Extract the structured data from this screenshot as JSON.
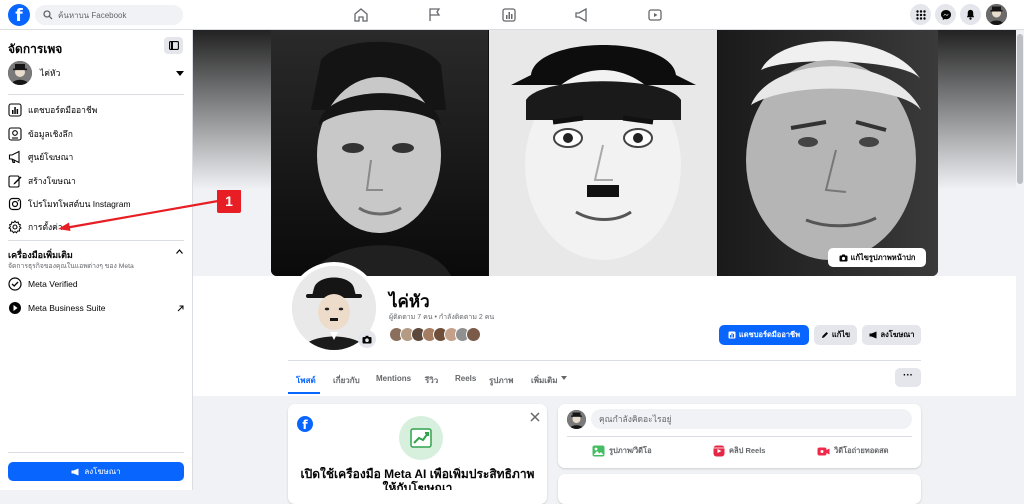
{
  "header": {
    "search_placeholder": "ค้นหาบน Facebook"
  },
  "sidebar": {
    "title": "จัดการเพจ",
    "profile_name": "ไค่หัว",
    "items": [
      {
        "label": "แดชบอร์ดมืออาชีพ",
        "icon": "dashboard-icon"
      },
      {
        "label": "ข้อมูลเชิงลึก",
        "icon": "insights-icon"
      },
      {
        "label": "ศูนย์โฆษณา",
        "icon": "megaphone-icon"
      },
      {
        "label": "สร้างโฆษณา",
        "icon": "edit-icon"
      },
      {
        "label": "โปรโมทโพสต์บน Instagram",
        "icon": "instagram-icon"
      },
      {
        "label": "การตั้งค่า",
        "icon": "gear-icon"
      }
    ],
    "tools_title": "เครื่องมือเพิ่มเติม",
    "tools_subtitle": "จัดการธุรกิจของคุณในแอพต่างๆ ของ Meta",
    "tools": [
      {
        "label": "Meta Verified",
        "icon": "verified-icon"
      },
      {
        "label": "Meta Business Suite",
        "icon": "business-suite-icon"
      }
    ],
    "promote_label": "ลงโฆษณา"
  },
  "annotation": {
    "number": "1"
  },
  "page": {
    "name": "ไค่หัว",
    "stats": "ผู้ติดตาม 7 คน • กำลังติดตาม 2 คน",
    "edit_cover": "แก้ไขรูปภาพหน้าปก",
    "dashboard_btn": "แดชบอร์ดมืออาชีพ",
    "edit_btn": "แก้ไข",
    "ads_btn": "ลงโฆษณา",
    "tabs": [
      "โพสต์",
      "เกี่ยวกับ",
      "Mentions",
      "รีวิว",
      "Reels",
      "รูปภาพ",
      "เพิ่มเติม"
    ]
  },
  "meta_ai_card": {
    "title": "เปิดใช้เครื่องมือ Meta AI เพื่อเพิ่มประสิทธิภาพให้กับโฆษณา"
  },
  "composer": {
    "placeholder": "คุณกำลังคิดอะไรอยู่",
    "photo_video": "รูปภาพ/วิดีโอ",
    "reels": "คลิป Reels",
    "live": "วิดีโอถ่ายทอดสด"
  },
  "colors": {
    "brand": "#0866ff",
    "annotation": "#e81e25"
  }
}
